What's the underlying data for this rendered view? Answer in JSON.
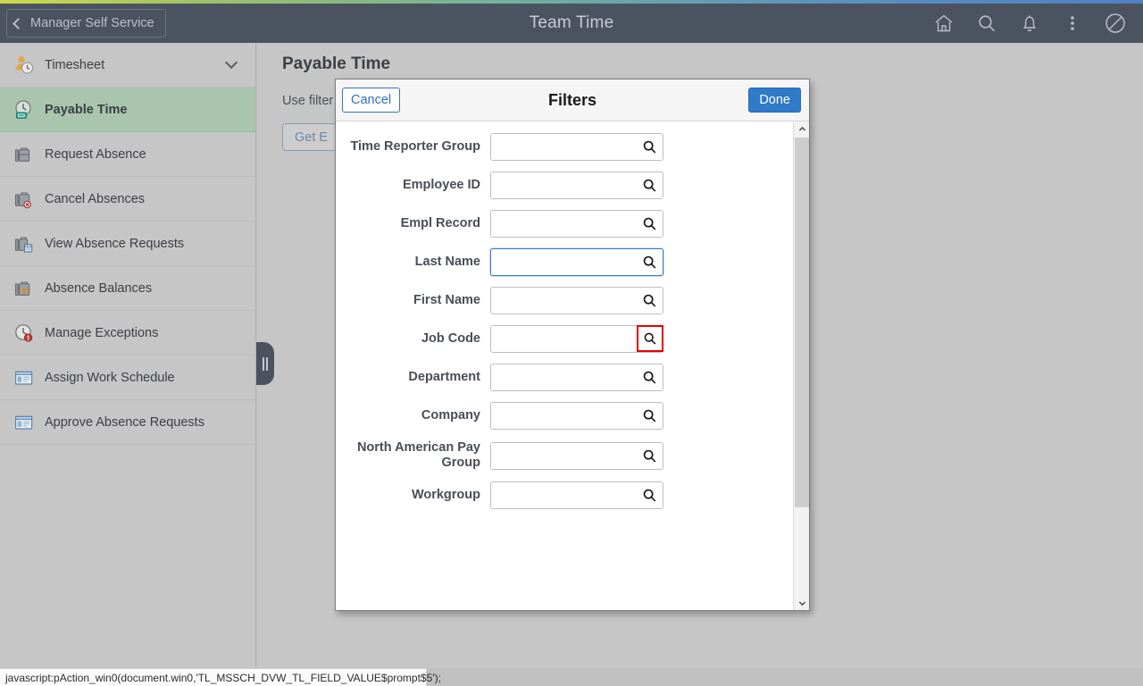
{
  "header": {
    "back_label": "Manager Self Service",
    "title": "Team Time",
    "icons": [
      {
        "name": "home-icon",
        "label": "Home"
      },
      {
        "name": "search-icon",
        "label": "Search"
      },
      {
        "name": "notifications-bell-icon",
        "label": "Notifications"
      },
      {
        "name": "actions-menu-icon",
        "label": "Actions"
      },
      {
        "name": "navbar-compass-icon",
        "label": "NavBar"
      }
    ]
  },
  "sidebar": {
    "items": [
      {
        "label": "Timesheet",
        "icon": "timesheet-person-clock-icon",
        "active": false,
        "has_chevron": true
      },
      {
        "label": "Payable Time",
        "icon": "payable-time-clock-icon",
        "active": true,
        "has_chevron": false
      },
      {
        "label": "Request Absence",
        "icon": "briefcase-icon",
        "active": false,
        "has_chevron": false
      },
      {
        "label": "Cancel Absences",
        "icon": "briefcase-cancel-icon",
        "active": false,
        "has_chevron": false
      },
      {
        "label": "View Absence Requests",
        "icon": "briefcase-calendar-icon",
        "active": false,
        "has_chevron": false
      },
      {
        "label": "Absence Balances",
        "icon": "briefcase-balance-icon",
        "active": false,
        "has_chevron": false
      },
      {
        "label": "Manage Exceptions",
        "icon": "clock-alert-icon",
        "active": false,
        "has_chevron": false
      },
      {
        "label": "Assign Work Schedule",
        "icon": "window-panel-icon",
        "active": false,
        "has_chevron": false
      },
      {
        "label": "Approve Absence Requests",
        "icon": "window-panel-icon",
        "active": false,
        "has_chevron": false
      }
    ],
    "collapse_handle": "collapse-sidebar-handle"
  },
  "main": {
    "page_title": "Payable Time",
    "description": "Use filter                                                        rch Options.",
    "get_employees_label": "Get E"
  },
  "modal": {
    "cancel_label": "Cancel",
    "title": "Filters",
    "done_label": "Done",
    "fields": [
      {
        "label": "Time Reporter Group",
        "value": "",
        "focused": false,
        "prompt_highlighted": false
      },
      {
        "label": "Employee ID",
        "value": "",
        "focused": false,
        "prompt_highlighted": false
      },
      {
        "label": "Empl Record",
        "value": "",
        "focused": false,
        "prompt_highlighted": false
      },
      {
        "label": "Last Name",
        "value": "",
        "focused": true,
        "prompt_highlighted": false
      },
      {
        "label": "First Name",
        "value": "",
        "focused": false,
        "prompt_highlighted": false
      },
      {
        "label": "Job Code",
        "value": "",
        "focused": false,
        "prompt_highlighted": true
      },
      {
        "label": "Department",
        "value": "",
        "focused": false,
        "prompt_highlighted": false
      },
      {
        "label": "Company",
        "value": "",
        "focused": false,
        "prompt_highlighted": false
      },
      {
        "label": "North American Pay Group",
        "value": "",
        "focused": false,
        "prompt_highlighted": false
      },
      {
        "label": "Workgroup",
        "value": "",
        "focused": false,
        "prompt_highlighted": false
      }
    ]
  },
  "statusbar": {
    "text": "javascript:pAction_win0(document.win0,'TL_MSSCH_DVW_TL_FIELD_VALUE$prompt$5');"
  },
  "colors": {
    "header_bg": "#4c5360",
    "sidebar_bg": "#c6c6c6",
    "active_item_bg": "#a9c5ae",
    "accent_blue": "#2f7ac9",
    "highlight_red": "#e60000"
  }
}
